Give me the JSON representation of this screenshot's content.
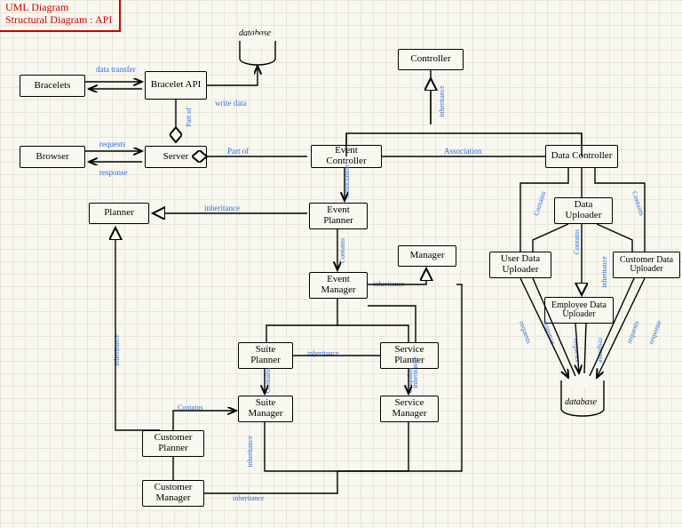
{
  "title": {
    "line1": "UML Diagram",
    "line2": "Structural Diagram : API"
  },
  "db": {
    "top": "database",
    "bottom": "database"
  },
  "nodes": {
    "bracelets": "Bracelets",
    "bracelet_api": "Bracelet API",
    "browser": "Browser",
    "server": "Server",
    "controller": "Controller",
    "event_controller": "Event Controller",
    "data_controller": "Data Controller",
    "planner": "Planner",
    "event_planner": "Event Planner",
    "manager": "Manager",
    "event_manager": "Event Manager",
    "data_uploader": "Data Uploader",
    "user_data_uploader": "User Data Uploader",
    "customer_data_uploader": "Customer Data Uploader",
    "employee_data_uploader": "Employee Data Uploader",
    "suite_planner": "Suite Planner",
    "service_planner": "Service Planner",
    "suite_manager": "Suite Manager",
    "service_manager": "Service Manager",
    "customer_planner": "Customer Planner",
    "customer_manager": "Customer Manager"
  },
  "edges": {
    "data_transfer": "data transfer",
    "write_data": "write data",
    "requests": "requests",
    "response": "response",
    "part_of_v": "Part of",
    "part_of_h": "Part of",
    "inheritance": "inheritance",
    "association": "Association",
    "contains": "Contains"
  }
}
